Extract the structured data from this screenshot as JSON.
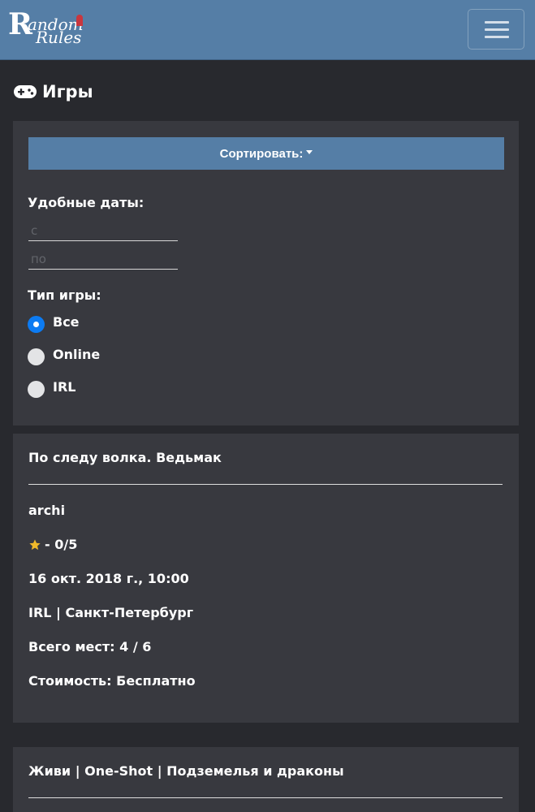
{
  "navbar": {
    "logo_letter": "R",
    "logo_line1": "andom",
    "logo_line2": "Rules",
    "brand_color": "#557ea6"
  },
  "page": {
    "title": "Игры",
    "icon": "gamepad-icon"
  },
  "filters": {
    "sort_label": "Сортировать:",
    "dates_label": "Удобные даты:",
    "from_placeholder": "с",
    "to_placeholder": "по",
    "game_type_label": "Тип игры:",
    "options": [
      {
        "label": "Все",
        "checked": true
      },
      {
        "label": "Online",
        "checked": false
      },
      {
        "label": "IRL",
        "checked": false
      }
    ]
  },
  "games": [
    {
      "title": "По следу волка. Ведьмак",
      "master": "archi",
      "rating": "- 0/5",
      "date": "16 окт. 2018 г., 10:00",
      "location": "IRL | Санкт-Петербург",
      "seats": "Всего мест: 4 / 6",
      "price": "Стоимость: Бесплатно"
    },
    {
      "title": "Живи | One-Shot | Подземелья и драконы"
    }
  ],
  "colors": {
    "star": "#f0b92a",
    "radio_checked": "#0c7bf2"
  }
}
